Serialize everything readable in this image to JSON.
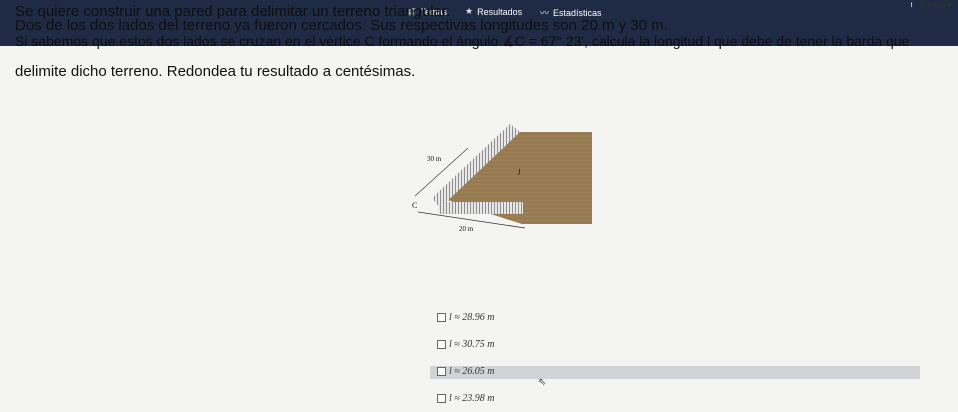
{
  "nav": {
    "temas": "Temas",
    "resultados": "Resultados",
    "estadisticas": "Estadísticas",
    "tutorial": "Tutorial"
  },
  "question": {
    "line1": "Se quiere construir una pared para delimitar un terreno triangular.",
    "line2": "Dos de los dos lados del terreno ya fueron cercados. Sus respectivas longitudes son 20 m y 30 m.",
    "line3": "Si sabemos que estos dos lados se cruzan en el vértice C formando el ángulo ∡C = 67° 23′, calcula la longitud l que debe de tener la barda que",
    "line4": "delimite dicho terreno. Redondea tu resultado a centésimas."
  },
  "figure": {
    "label_30": "30 m",
    "label_l": "l",
    "label_c": "C",
    "label_20": "20 m"
  },
  "options": [
    {
      "text": "l ≈ 28.96 m"
    },
    {
      "text": "l ≈ 30.75 m"
    },
    {
      "text": "l ≈ 26.05 m"
    },
    {
      "text": "l ≈ 23.98 m"
    }
  ]
}
